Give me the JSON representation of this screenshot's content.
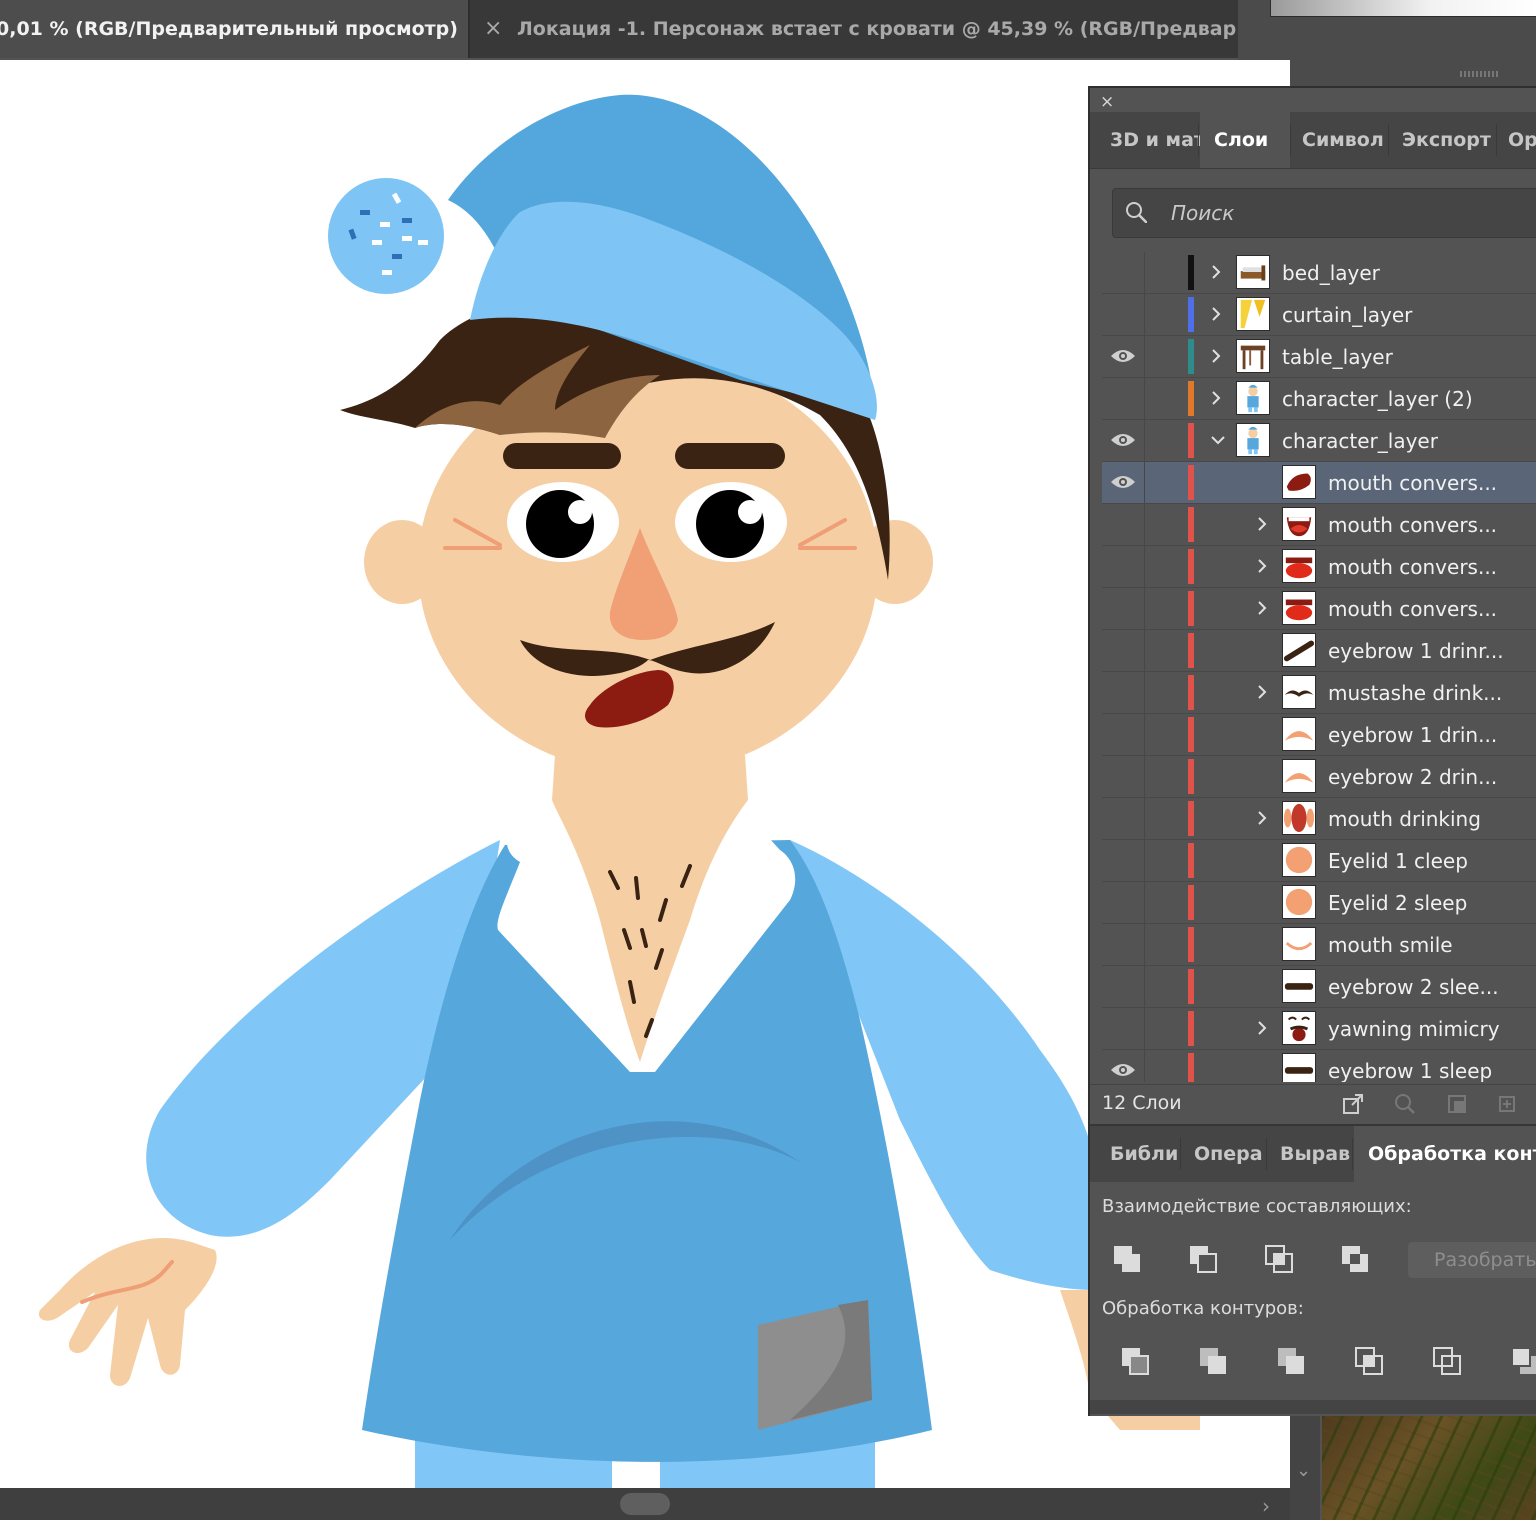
{
  "document_tabs": {
    "active": "0,01 % (RGB/Предварительный просмотр)",
    "inactive_close": "×",
    "inactive": "Локация -1. Персонаж встает с кровати @ 45,39 % (RGB/Предвар..."
  },
  "layers_panel": {
    "close": "×",
    "tabs": [
      "3D и мат",
      "Слои",
      "Символ",
      "Экспорт",
      "Op"
    ],
    "active_tab": "Слои",
    "search_placeholder": "Поиск",
    "layers": [
      {
        "name": "bed_layer",
        "color": "#111111",
        "expander": "collapsed",
        "visible": false,
        "level": 0,
        "thumb": "bed"
      },
      {
        "name": "curtain_layer",
        "color": "#4f6fe8",
        "expander": "collapsed",
        "visible": false,
        "level": 0,
        "thumb": "curtain"
      },
      {
        "name": "table_layer",
        "color": "#2f8c8c",
        "expander": "collapsed",
        "visible": true,
        "level": 0,
        "thumb": "table"
      },
      {
        "name": "character_layer (2)",
        "color": "#e07a2a",
        "expander": "collapsed",
        "visible": false,
        "level": 0,
        "thumb": "character"
      },
      {
        "name": "character_layer",
        "color": "#e0534a",
        "expander": "expanded",
        "visible": true,
        "level": 0,
        "thumb": "character"
      },
      {
        "name": "mouth convers...",
        "color": "#e0534a",
        "expander": "none",
        "visible": true,
        "level": 1,
        "thumb": "mouth-dark",
        "selected": true
      },
      {
        "name": "mouth convers...",
        "color": "#e0534a",
        "expander": "collapsed",
        "visible": false,
        "level": 1,
        "thumb": "mouth-open"
      },
      {
        "name": "mouth convers...",
        "color": "#e0534a",
        "expander": "collapsed",
        "visible": false,
        "level": 1,
        "thumb": "mouth-red"
      },
      {
        "name": "mouth convers...",
        "color": "#e0534a",
        "expander": "collapsed",
        "visible": false,
        "level": 1,
        "thumb": "mouth-red"
      },
      {
        "name": "eyebrow 1 drinr...",
        "color": "#e0534a",
        "expander": "none",
        "visible": false,
        "level": 1,
        "thumb": "brow-diag"
      },
      {
        "name": "mustashe drink...",
        "color": "#e0534a",
        "expander": "collapsed",
        "visible": false,
        "level": 1,
        "thumb": "mustache"
      },
      {
        "name": "eyebrow 1 drin...",
        "color": "#e0534a",
        "expander": "none",
        "visible": false,
        "level": 1,
        "thumb": "arc-orange"
      },
      {
        "name": "eyebrow 2 drin...",
        "color": "#e0534a",
        "expander": "none",
        "visible": false,
        "level": 1,
        "thumb": "arc-orange"
      },
      {
        "name": "mouth drinking",
        "color": "#e0534a",
        "expander": "collapsed",
        "visible": false,
        "level": 1,
        "thumb": "mouth-drink"
      },
      {
        "name": "Eyelid 1 cleep",
        "color": "#e0534a",
        "expander": "none",
        "visible": false,
        "level": 1,
        "thumb": "eyelid"
      },
      {
        "name": "Eyelid 2 sleep",
        "color": "#e0534a",
        "expander": "none",
        "visible": false,
        "level": 1,
        "thumb": "eyelid"
      },
      {
        "name": "mouth smile",
        "color": "#e0534a",
        "expander": "none",
        "visible": false,
        "level": 1,
        "thumb": "smile"
      },
      {
        "name": "eyebrow 2 slee...",
        "color": "#e0534a",
        "expander": "none",
        "visible": false,
        "level": 1,
        "thumb": "brow-flat"
      },
      {
        "name": "yawning mimicry",
        "color": "#e0534a",
        "expander": "collapsed",
        "visible": false,
        "level": 1,
        "thumb": "yawn"
      },
      {
        "name": "eyebrow 1 sleep",
        "color": "#e0534a",
        "expander": "none",
        "visible": true,
        "level": 1,
        "thumb": "brow-flat"
      }
    ],
    "footer_count": "12 Слои"
  },
  "pathfinder_panel": {
    "tabs": [
      "Библи",
      "Опера",
      "Вырав",
      "Обработка конту"
    ],
    "active_tab": "Обработка конту",
    "shape_modes_label": "Взаимодействие составляющих:",
    "expand_button": "Разобрать",
    "pathfinders_label": "Обработка контуров:"
  },
  "colors": {
    "hat": "#54a7dc",
    "hat_light": "#7ec5f5",
    "skin": "#f5cfa3",
    "hair": "#3b2313",
    "shirt": "#55a7dc",
    "sleeve": "#80c6f6",
    "mouth": "#8c1b12"
  }
}
